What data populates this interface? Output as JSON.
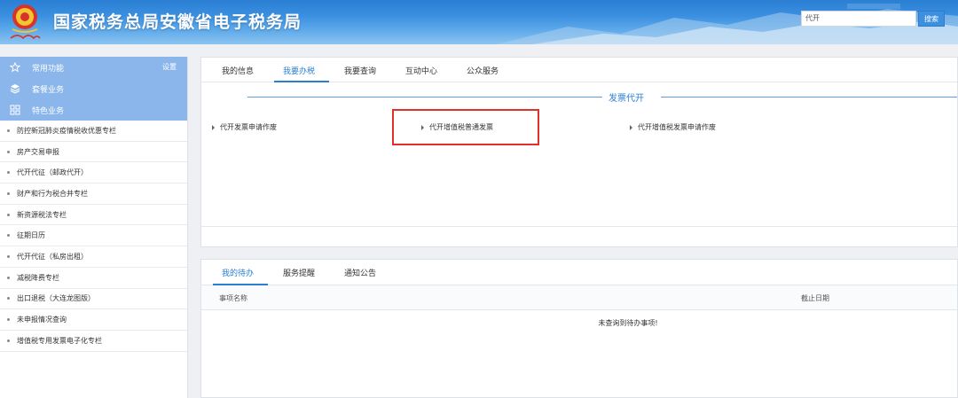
{
  "header": {
    "title": "国家税务总局安徽省电子税务局",
    "search_value": "代开",
    "search_button": "搜索",
    "logo_icon": "tax-emblem-icon",
    "accent": "#2a7fd4"
  },
  "sidebar": {
    "settings_label": "设置",
    "top_items": [
      {
        "label": "常用功能",
        "icon": "star-icon"
      },
      {
        "label": "套餐业务",
        "icon": "package-icon"
      },
      {
        "label": "特色业务",
        "icon": "grid-icon"
      }
    ],
    "items": [
      "防控新冠肺炎疫情税收优惠专栏",
      "房产交易申报",
      "代开代征（邮政代开）",
      "财产和行为税合并专栏",
      "新资源税法专栏",
      "征期日历",
      "代开代征（私房出租）",
      "减税降费专栏",
      "出口退税（大连龙图版）",
      "未申报情况查询",
      "增值税专用发票电子化专栏"
    ]
  },
  "main": {
    "tabs": [
      "我的信息",
      "我要办税",
      "我要查询",
      "互动中心",
      "公众服务"
    ],
    "active_tab": "我要办税",
    "section_title": "发票代开",
    "links": [
      "代开发票申请作废",
      "代开增值税普通发票",
      "代开增值税发票申请作废"
    ]
  },
  "bottom": {
    "tabs": [
      "我的待办",
      "服务提醒",
      "通知公告"
    ],
    "active_tab": "我的待办",
    "columns": [
      "事项名称",
      "截止日期"
    ],
    "empty_message": "未查询到待办事项!"
  }
}
